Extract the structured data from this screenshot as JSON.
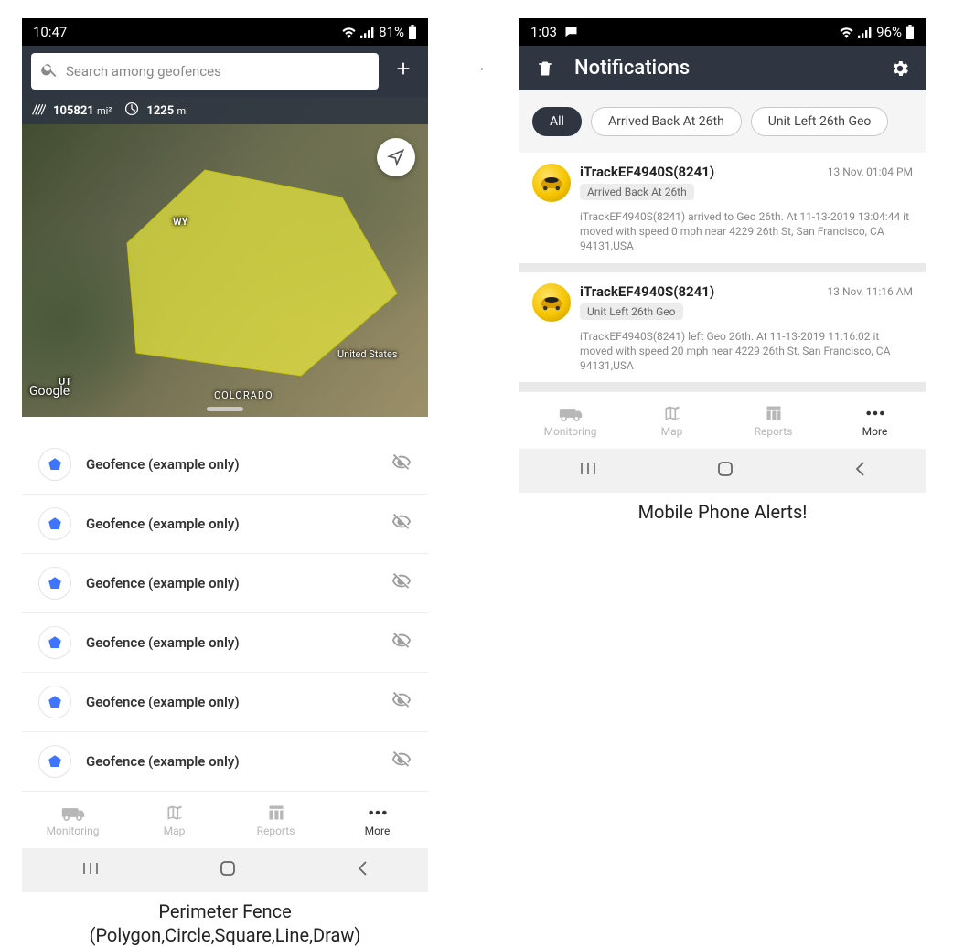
{
  "left": {
    "status": {
      "time": "10:47",
      "battery": "81%"
    },
    "search": {
      "placeholder": "Search among geofences"
    },
    "overlay": {
      "area_value": "105821",
      "area_unit": "mi²",
      "radius_value": "1225",
      "radius_unit": "mi"
    },
    "map_labels": {
      "wy": "WY",
      "ut": "UT",
      "co": "COLORADO",
      "us": "United States",
      "google": "Google"
    },
    "geofences": [
      {
        "label": "Geofence (example only)"
      },
      {
        "label": "Geofence (example only)"
      },
      {
        "label": "Geofence (example only)"
      },
      {
        "label": "Geofence (example only)"
      },
      {
        "label": "Geofence (example only)"
      },
      {
        "label": "Geofence (example only)"
      }
    ],
    "tabs": {
      "monitoring": "Monitoring",
      "map": "Map",
      "reports": "Reports",
      "more": "More"
    }
  },
  "right": {
    "status": {
      "time": "1:03",
      "battery": "96%"
    },
    "title": "Notifications",
    "chips": [
      {
        "label": "All",
        "active": true
      },
      {
        "label": "Arrived Back At 26th",
        "active": false
      },
      {
        "label": "Unit Left 26th Geo",
        "active": false
      }
    ],
    "notifications": [
      {
        "title": "iTrackEF4940S(8241)",
        "tag": "Arrived Back At 26th",
        "time": "13 Nov, 01:04 PM",
        "body": "iTrackEF4940S(8241) arrived to Geo 26th.     At 11-13-2019 13:04:44 it moved with speed 0 mph near 4229 26th St, San Francisco, CA 94131,USA"
      },
      {
        "title": "iTrackEF4940S(8241)",
        "tag": "Unit Left 26th Geo",
        "time": "13 Nov, 11:16 AM",
        "body": "iTrackEF4940S(8241) left Geo 26th.     At 11-13-2019 11:16:02 it moved with speed 20 mph near 4229 26th St, San Francisco, CA 94131,USA"
      }
    ],
    "tabs": {
      "monitoring": "Monitoring",
      "map": "Map",
      "reports": "Reports",
      "more": "More"
    }
  },
  "captions": {
    "left_line1": "Perimeter Fence",
    "left_line2": "(Polygon,Circle,Square,Line,Draw)",
    "right": "Mobile Phone Alerts!"
  }
}
